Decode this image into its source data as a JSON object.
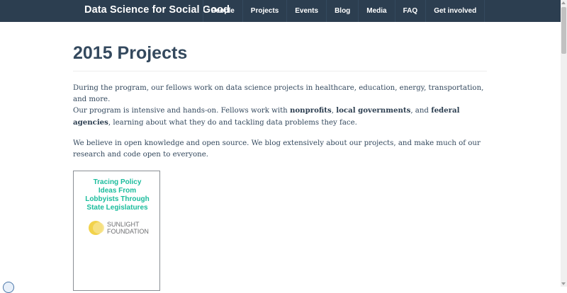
{
  "navbar": {
    "brand": "Data Science for Social Good",
    "items": [
      "People",
      "Projects",
      "Events",
      "Blog",
      "Media",
      "FAQ",
      "Get involved"
    ]
  },
  "page": {
    "title": "2015 Projects",
    "para1": "During the program, our fellows work on data science projects in healthcare, education, energy, transportation, and more.",
    "para2": {
      "t1": "Our program is intensive and hands-on. Fellows work with ",
      "b1": "nonprofits",
      "t2": ", ",
      "b2": "local governments",
      "t3": ", and ",
      "b3": "federal agencies",
      "t4": ", learning about what they do and tackling data problems they face."
    },
    "para3": "We believe in open knowledge and open source. We blog extensively about our projects, and make much of our research and code open to everyone."
  },
  "project_card": {
    "title_lines": [
      "Tracing Policy",
      "Ideas From",
      "Lobbyists Through",
      "State Legislatures"
    ],
    "logo_line1": "SUNLIGHT",
    "logo_line2": "FOUNDATION",
    "title_color": "#1abc9c"
  },
  "icons": {
    "logo": "sunlight-foundation-logo-icon",
    "corner": "browser-status-icon",
    "scroll_up": "scroll-up-arrow-icon",
    "scroll_down": "scroll-down-arrow-icon"
  },
  "colors": {
    "navbar": "#2c3e50",
    "text": "#34495e",
    "accent": "#1abc9c"
  }
}
